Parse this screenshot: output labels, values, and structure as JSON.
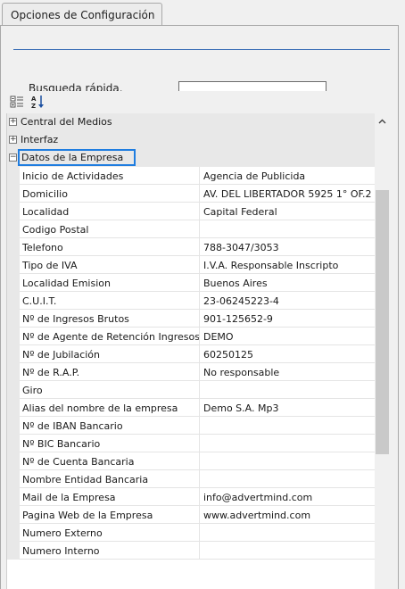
{
  "tab": {
    "title": "Opciones de Configuración"
  },
  "search": {
    "label": "Busqueda rápida.",
    "value": ""
  },
  "toolbar": {
    "categorized_icon": "categorized-icon",
    "alphabetical_icon": "sort-alphabetical-icon"
  },
  "categories": [
    {
      "label": "Central del Medios",
      "state": "collapsed"
    },
    {
      "label": "Interfaz",
      "state": "collapsed"
    },
    {
      "label": "Datos de la Empresa",
      "state": "expanded"
    }
  ],
  "properties": [
    {
      "name": "Inicio de Actividades",
      "value": "Agencia de Publicida"
    },
    {
      "name": "Domicilio",
      "value": "AV. DEL LIBERTADOR 5925 1° OF.2"
    },
    {
      "name": "Localidad",
      "value": "Capital Federal"
    },
    {
      "name": "Codigo Postal",
      "value": ""
    },
    {
      "name": "Telefono",
      "value": "788-3047/3053"
    },
    {
      "name": "Tipo de IVA",
      "value": "I.V.A. Responsable Inscripto"
    },
    {
      "name": "Localidad Emision",
      "value": "Buenos Aires"
    },
    {
      "name": "C.U.I.T.",
      "value": "23-06245223-4"
    },
    {
      "name": "Nº de Ingresos Brutos",
      "value": "901-125652-9"
    },
    {
      "name": "Nº de Agente de Retención Ingresos Bru",
      "value": "DEMO"
    },
    {
      "name": "Nº de Jubilación",
      "value": "60250125"
    },
    {
      "name": "Nº de R.A.P.",
      "value": "No responsable"
    },
    {
      "name": "Giro",
      "value": ""
    },
    {
      "name": "Alias del nombre de la empresa",
      "value": "Demo S.A. Mp3"
    },
    {
      "name": "Nº de IBAN Bancario",
      "value": ""
    },
    {
      "name": "Nº BIC Bancario",
      "value": ""
    },
    {
      "name": "Nº de Cuenta Bancaria",
      "value": ""
    },
    {
      "name": "Nombre Entidad Bancaria",
      "value": ""
    },
    {
      "name": "Mail de la Empresa",
      "value": "info@advertmind.com"
    },
    {
      "name": "Pagina Web de la Empresa",
      "value": "www.advertmind.com"
    },
    {
      "name": "Numero Externo",
      "value": ""
    },
    {
      "name": "Numero Interno",
      "value": ""
    }
  ],
  "colors": {
    "accent": "#1f7de0",
    "divider": "#3b6fb6",
    "category_bg": "#e8e8e8"
  }
}
